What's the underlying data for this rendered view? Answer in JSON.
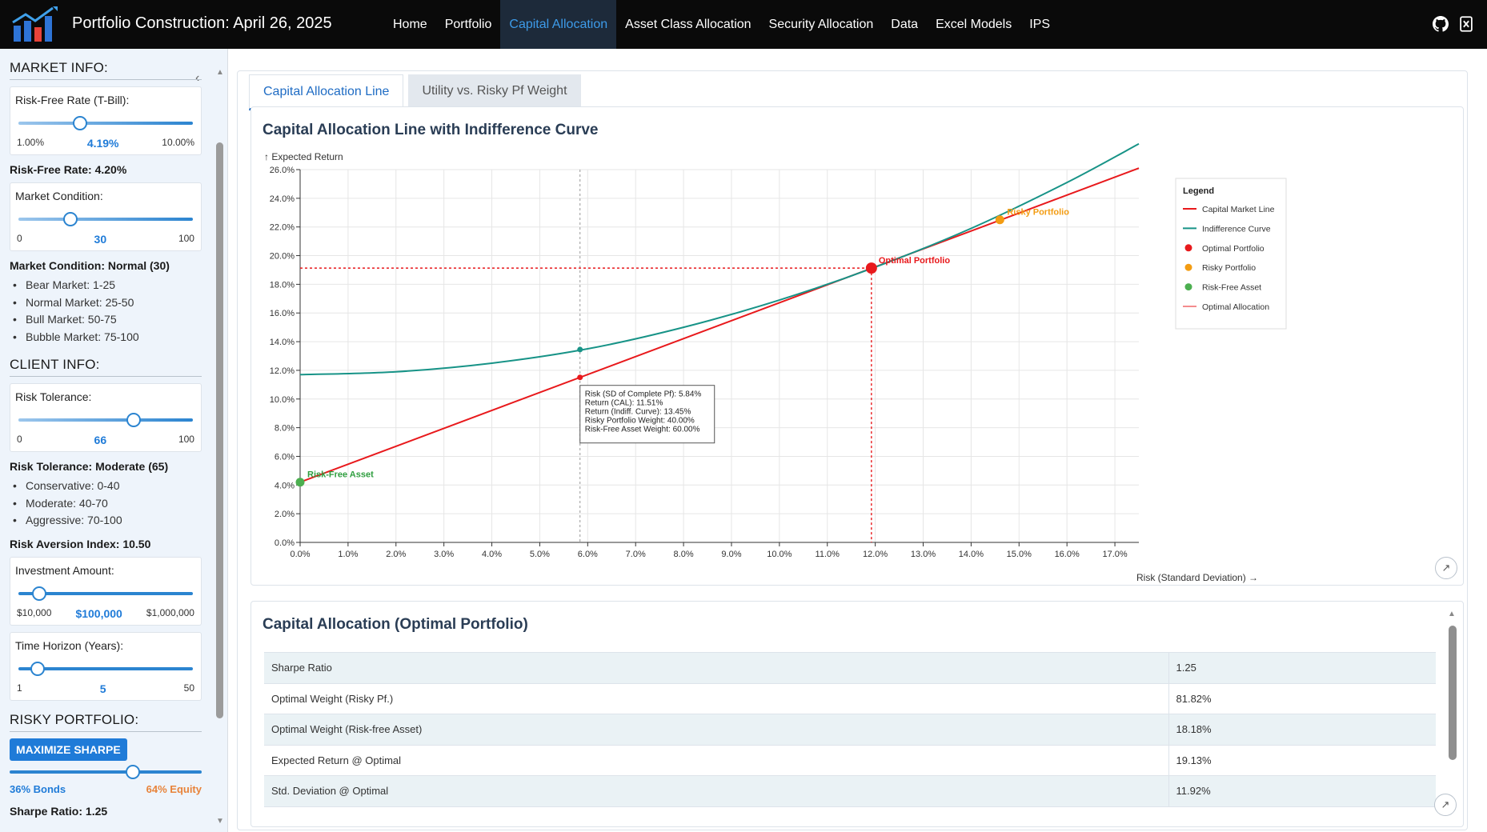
{
  "app": {
    "title": "Portfolio Construction: April 26, 2025",
    "nav": [
      "Home",
      "Portfolio",
      "Capital Allocation",
      "Asset Class Allocation",
      "Security Allocation",
      "Data",
      "Excel Models",
      "IPS"
    ],
    "active_nav": "Capital Allocation",
    "icons": [
      "github-icon",
      "excel-icon"
    ]
  },
  "sidebar": {
    "market_info_title": "MARKET INFO:",
    "rf_slider": {
      "label": "Risk-Free Rate (T-Bill):",
      "min": "1.00%",
      "value": "4.19%",
      "max": "10.00%",
      "fraction": 0.354
    },
    "rf_text": "Risk-Free Rate: 4.20%",
    "market_slider": {
      "label": "Market Condition:",
      "min": "0",
      "value": "30",
      "max": "100",
      "fraction": 0.3
    },
    "market_text": "Market Condition: Normal (30)",
    "market_list": [
      "Bear Market: 1-25",
      "Normal Market: 25-50",
      "Bull Market: 50-75",
      "Bubble Market: 75-100"
    ],
    "client_info_title": "CLIENT INFO:",
    "risk_slider": {
      "label": "Risk Tolerance:",
      "min": "0",
      "value": "66",
      "max": "100",
      "fraction": 0.66
    },
    "risk_text": "Risk Tolerance: Moderate (65)",
    "risk_list": [
      "Conservative: 0-40",
      "Moderate: 40-70",
      "Aggressive: 70-100"
    ],
    "risk_aversion_text": "Risk Aversion Index: 10.50",
    "invest_slider": {
      "label": "Investment Amount:",
      "min": "$10,000",
      "value": "$100,000",
      "max": "$1,000,000",
      "fraction": 0.12
    },
    "horizon_slider": {
      "label": "Time Horizon (Years):",
      "min": "1",
      "value": "5",
      "max": "50",
      "fraction": 0.11
    },
    "risky_pf_title": "RISKY PORTFOLIO:",
    "maximize_button": "MAXIMIZE SHARPE",
    "mix_slider": {
      "fraction": 0.64
    },
    "bonds_label": "36% Bonds",
    "equity_label": "64% Equity",
    "sharpe_text": "Sharpe Ratio: 1.25"
  },
  "tabs": [
    "Capital Allocation Line",
    "Utility vs. Risky Pf Weight"
  ],
  "chart_card": {
    "title": "Capital Allocation Line with Indifference Curve"
  },
  "chart_data": {
    "type": "line",
    "title": "Capital Allocation Line with Indifference Curve",
    "xlabel": "Risk (Standard Deviation) →",
    "ylabel": "↑ Expected Return",
    "xlim": [
      0,
      17.5
    ],
    "ylim": [
      0,
      26
    ],
    "xticks": [
      "0.0%",
      "1.0%",
      "2.0%",
      "3.0%",
      "4.0%",
      "5.0%",
      "6.0%",
      "7.0%",
      "8.0%",
      "9.0%",
      "10.0%",
      "11.0%",
      "12.0%",
      "13.0%",
      "14.0%",
      "15.0%",
      "16.0%",
      "17.0%"
    ],
    "yticks": [
      "0.0%",
      "2.0%",
      "4.0%",
      "6.0%",
      "8.0%",
      "10.0%",
      "12.0%",
      "14.0%",
      "16.0%",
      "18.0%",
      "20.0%",
      "22.0%",
      "24.0%",
      "26.0%"
    ],
    "grid": true,
    "legend_title": "Legend",
    "legend_placement": "top-right",
    "series": [
      {
        "name": "Capital Market Line",
        "color": "#e8191c",
        "x": [
          0,
          17.5
        ],
        "y": [
          4.2,
          26.1
        ]
      },
      {
        "name": "Indifference Curve",
        "color": "#179387",
        "x": [
          0,
          2,
          4,
          6,
          8,
          10,
          12,
          14,
          16,
          17.5
        ],
        "y": [
          11.7,
          11.9,
          12.5,
          13.5,
          15.0,
          16.9,
          19.2,
          21.9,
          25.1,
          27.8
        ]
      }
    ],
    "points": [
      {
        "name": "Optimal Portfolio",
        "label": "Optimal Portfolio",
        "color": "#e8191c",
        "x": 11.92,
        "y": 19.13,
        "label_color": "#e8191c"
      },
      {
        "name": "Risky Portfolio",
        "label": "Risky Portfolio",
        "color": "#f39c12",
        "x": 14.6,
        "y": 22.5,
        "label_color": "#f39c12"
      },
      {
        "name": "Risk-Free Asset",
        "label": "Risk-Free Asset",
        "color": "#4caf50",
        "x": 0,
        "y": 4.2,
        "label_color": "#2f9e3f"
      }
    ],
    "legend": [
      {
        "name": "Capital Market Line",
        "kind": "line",
        "color": "#e8191c"
      },
      {
        "name": "Indifference Curve",
        "kind": "line",
        "color": "#179387"
      },
      {
        "name": "Optimal Portfolio",
        "kind": "dot",
        "color": "#e8191c"
      },
      {
        "name": "Risky Portfolio",
        "kind": "dot",
        "color": "#f39c12"
      },
      {
        "name": "Risk-Free Asset",
        "kind": "dot",
        "color": "#4caf50"
      },
      {
        "name": "Optimal Allocation",
        "kind": "thin-line",
        "color": "#e8191c"
      }
    ],
    "hover": {
      "x": 5.84,
      "y_cal": 11.51,
      "y_curve": 13.45,
      "lines": [
        "Risk (SD of Complete Pf): 5.84%",
        "Return (CAL): 11.51%",
        "Return (Indiff. Curve): 13.45%",
        "Risky Portfolio Weight: 40.00%",
        "Risk-Free Asset Weight: 60.00%"
      ]
    },
    "colors": {
      "cml": "#e8191c",
      "curve": "#179387",
      "grid": "#e6e6e6",
      "axis": "#333333"
    }
  },
  "table_card": {
    "title": "Capital Allocation (Optimal Portfolio)",
    "rows": [
      [
        "Sharpe Ratio",
        "1.25"
      ],
      [
        "Optimal Weight (Risky Pf.)",
        "81.82%"
      ],
      [
        "Optimal Weight (Risk-free Asset)",
        "18.18%"
      ],
      [
        "Expected Return @ Optimal",
        "19.13%"
      ],
      [
        "Std. Deviation @ Optimal",
        "11.92%"
      ]
    ]
  }
}
